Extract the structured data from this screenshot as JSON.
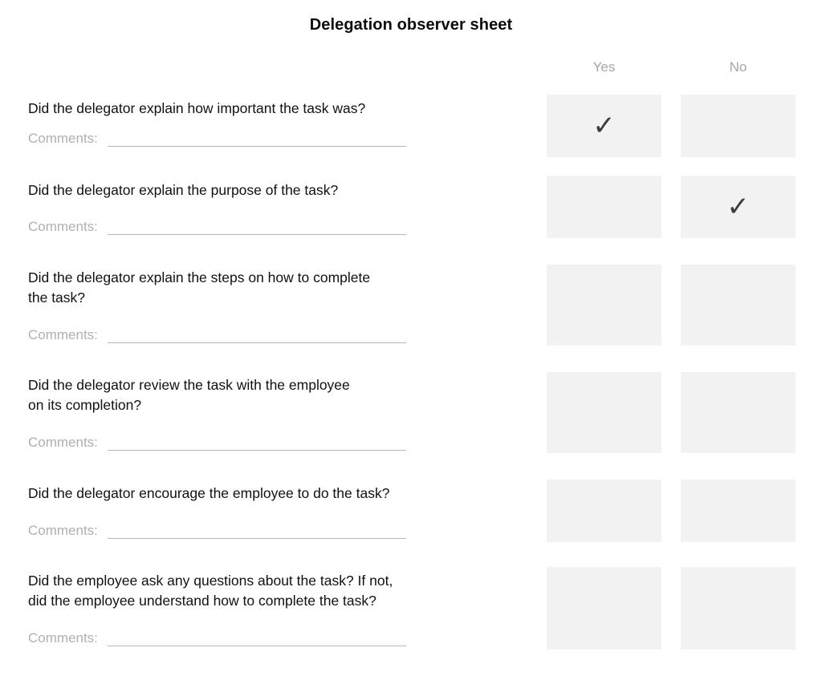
{
  "sheet": {
    "title": "Delegation observer sheet",
    "columns": [
      {
        "key": "yes",
        "label": "Yes"
      },
      {
        "key": "no",
        "label": "No"
      }
    ],
    "comments_label": "Comments:",
    "check_glyph": "✓",
    "colors": {
      "cell_background": "#f2f2f2",
      "check": "#3d3d3d",
      "header_text": "#a6a6a6",
      "question_text": "#111111",
      "comments_text": "#b0b0b0",
      "comments_rule": "#b8b8b8",
      "page_background": "#ffffff"
    },
    "rows": [
      {
        "index": 1,
        "question": "Did the delegator explain how important the task was?",
        "yes": "✓",
        "no": "",
        "answer": "yes"
      },
      {
        "index": 2,
        "question": "Did the delegator explain the purpose of the task?",
        "yes": "",
        "no": "✓",
        "answer": "no"
      },
      {
        "index": 3,
        "question": "Did the delegator explain the steps on how to complete\nthe task?",
        "yes": "",
        "no": "",
        "answer": ""
      },
      {
        "index": 4,
        "question": "Did the delegator review the task with the employee\non its completion?",
        "yes": "",
        "no": "",
        "answer": ""
      },
      {
        "index": 5,
        "question": "Did the delegator encourage the employee to do the task?",
        "yes": "",
        "no": "",
        "answer": ""
      },
      {
        "index": 6,
        "question": "Did the employee ask any questions about the task? If not,\ndid the employee understand how to complete the task?",
        "yes": "",
        "no": "",
        "answer": ""
      }
    ]
  }
}
